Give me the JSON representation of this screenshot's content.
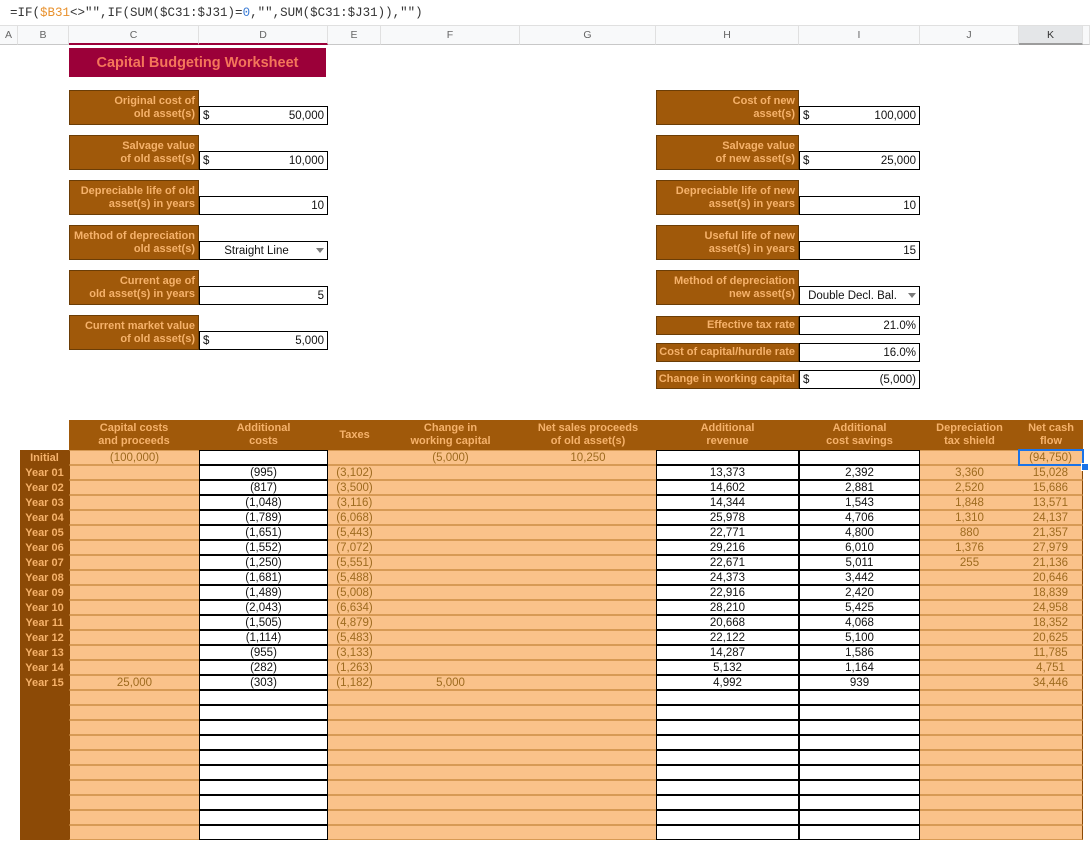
{
  "formula_bar": {
    "formula": "=IF($B31<>\"\",IF(SUM($C31:$J31)=0,\"\",SUM($C31:$J31)),\"\")",
    "parts": {
      "p1": "=IF(",
      "ref1": "$B31",
      "p2": "<>\"\",IF(SUM($C31:$J31)=",
      "num1": "0",
      "p3": ",\"\",SUM($C31:$J31)),\"\")"
    }
  },
  "columns": [
    {
      "label": "A",
      "width": 18
    },
    {
      "label": "B",
      "width": 51
    },
    {
      "label": "C",
      "width": 130
    },
    {
      "label": "D",
      "width": 129
    },
    {
      "label": "E",
      "width": 53
    },
    {
      "label": "F",
      "width": 139
    },
    {
      "label": "G",
      "width": 136
    },
    {
      "label": "H",
      "width": 143
    },
    {
      "label": "I",
      "width": 121
    },
    {
      "label": "J",
      "width": 99
    },
    {
      "label": "K",
      "width": 64
    },
    {
      "label": "",
      "width": 7
    }
  ],
  "selected_column": "K",
  "title": "Capital Budgeting Worksheet",
  "inputs_left": [
    {
      "label_line1": "Original cost of",
      "label_line2": "old asset(s)",
      "currency": "$",
      "value": "50,000",
      "type": "currency"
    },
    {
      "label_line1": "Salvage value",
      "label_line2": "of old asset(s)",
      "currency": "$",
      "value": "10,000",
      "type": "currency"
    },
    {
      "label_line1": "Depreciable life of old",
      "label_line2": "asset(s) in years",
      "currency": "",
      "value": "10",
      "type": "number"
    },
    {
      "label_line1": "Method of depreciation",
      "label_line2": "old asset(s)",
      "currency": "",
      "value": "Straight Line",
      "type": "dropdown"
    },
    {
      "label_line1": "Current age of",
      "label_line2": "old asset(s) in years",
      "currency": "",
      "value": "5",
      "type": "number"
    },
    {
      "label_line1": "Current market value",
      "label_line2": "of old asset(s)",
      "currency": "$",
      "value": "5,000",
      "type": "currency"
    }
  ],
  "inputs_right": [
    {
      "label_line1": "Cost of new",
      "label_line2": "asset(s)",
      "currency": "$",
      "value": "100,000",
      "type": "currency"
    },
    {
      "label_line1": "Salvage value",
      "label_line2": "of new asset(s)",
      "currency": "$",
      "value": "25,000",
      "type": "currency"
    },
    {
      "label_line1": "Depreciable life of new",
      "label_line2": "asset(s) in years",
      "currency": "",
      "value": "10",
      "type": "number"
    },
    {
      "label_line1": "Useful life of new",
      "label_line2": "asset(s) in years",
      "currency": "",
      "value": "15",
      "type": "number"
    },
    {
      "label_line1": "Method of depreciation",
      "label_line2": "new asset(s)",
      "currency": "",
      "value": "Double Decl. Bal.",
      "type": "dropdown"
    },
    {
      "label_line1": "",
      "label_line2": "Effective tax rate",
      "currency": "",
      "value": "21.0%",
      "type": "number"
    },
    {
      "label_line1": "",
      "label_line2": "Cost of capital/hurdle rate",
      "currency": "",
      "value": "16.0%",
      "type": "number"
    },
    {
      "label_line1": "",
      "label_line2": "Change in working capital",
      "currency": "$",
      "value": "(5,000)",
      "type": "currency"
    }
  ],
  "table": {
    "headers": [
      {
        "line1": "Capital costs",
        "line2": "and proceeds"
      },
      {
        "line1": "Additional",
        "line2": "costs"
      },
      {
        "line1": "",
        "line2": "Taxes"
      },
      {
        "line1": "Change in",
        "line2": "working capital"
      },
      {
        "line1": "Net sales proceeds",
        "line2": "of old asset(s)"
      },
      {
        "line1": "Additional",
        "line2": "revenue"
      },
      {
        "line1": "Additional",
        "line2": "cost savings"
      },
      {
        "line1": "Depreciation",
        "line2": "tax shield"
      },
      {
        "line1": "Net cash",
        "line2": "flow"
      }
    ],
    "column_kinds": [
      "calc",
      "input",
      "calc",
      "calc",
      "calc",
      "input",
      "input",
      "calc",
      "calc"
    ],
    "rows": [
      {
        "label": "Initial",
        "cells": [
          "(100,000)",
          "",
          "",
          "(5,000)",
          "10,250",
          "",
          "",
          "",
          "(94,750)"
        ]
      },
      {
        "label": "Year 01",
        "cells": [
          "",
          "(995)",
          "(3,102)",
          "",
          "",
          "13,373",
          "2,392",
          "3,360",
          "15,028"
        ]
      },
      {
        "label": "Year 02",
        "cells": [
          "",
          "(817)",
          "(3,500)",
          "",
          "",
          "14,602",
          "2,881",
          "2,520",
          "15,686"
        ]
      },
      {
        "label": "Year 03",
        "cells": [
          "",
          "(1,048)",
          "(3,116)",
          "",
          "",
          "14,344",
          "1,543",
          "1,848",
          "13,571"
        ]
      },
      {
        "label": "Year 04",
        "cells": [
          "",
          "(1,789)",
          "(6,068)",
          "",
          "",
          "25,978",
          "4,706",
          "1,310",
          "24,137"
        ]
      },
      {
        "label": "Year 05",
        "cells": [
          "",
          "(1,651)",
          "(5,443)",
          "",
          "",
          "22,771",
          "4,800",
          "880",
          "21,357"
        ]
      },
      {
        "label": "Year 06",
        "cells": [
          "",
          "(1,552)",
          "(7,072)",
          "",
          "",
          "29,216",
          "6,010",
          "1,376",
          "27,979"
        ]
      },
      {
        "label": "Year 07",
        "cells": [
          "",
          "(1,250)",
          "(5,551)",
          "",
          "",
          "22,671",
          "5,011",
          "255",
          "21,136"
        ]
      },
      {
        "label": "Year 08",
        "cells": [
          "",
          "(1,681)",
          "(5,488)",
          "",
          "",
          "24,373",
          "3,442",
          "",
          "20,646"
        ]
      },
      {
        "label": "Year 09",
        "cells": [
          "",
          "(1,489)",
          "(5,008)",
          "",
          "",
          "22,916",
          "2,420",
          "",
          "18,839"
        ]
      },
      {
        "label": "Year 10",
        "cells": [
          "",
          "(2,043)",
          "(6,634)",
          "",
          "",
          "28,210",
          "5,425",
          "",
          "24,958"
        ]
      },
      {
        "label": "Year 11",
        "cells": [
          "",
          "(1,505)",
          "(4,879)",
          "",
          "",
          "20,668",
          "4,068",
          "",
          "18,352"
        ]
      },
      {
        "label": "Year 12",
        "cells": [
          "",
          "(1,114)",
          "(5,483)",
          "",
          "",
          "22,122",
          "5,100",
          "",
          "20,625"
        ]
      },
      {
        "label": "Year 13",
        "cells": [
          "",
          "(955)",
          "(3,133)",
          "",
          "",
          "14,287",
          "1,586",
          "",
          "11,785"
        ]
      },
      {
        "label": "Year 14",
        "cells": [
          "",
          "(282)",
          "(1,263)",
          "",
          "",
          "5,132",
          "1,164",
          "",
          "4,751"
        ]
      },
      {
        "label": "Year 15",
        "cells": [
          "25,000",
          "(303)",
          "(1,182)",
          "5,000",
          "",
          "4,992",
          "939",
          "",
          "34,446"
        ]
      },
      {
        "label": "",
        "cells": [
          "",
          "",
          "",
          "",
          "",
          "",
          "",
          "",
          ""
        ]
      },
      {
        "label": "",
        "cells": [
          "",
          "",
          "",
          "",
          "",
          "",
          "",
          "",
          ""
        ]
      },
      {
        "label": "",
        "cells": [
          "",
          "",
          "",
          "",
          "",
          "",
          "",
          "",
          ""
        ]
      },
      {
        "label": "",
        "cells": [
          "",
          "",
          "",
          "",
          "",
          "",
          "",
          "",
          ""
        ]
      },
      {
        "label": "",
        "cells": [
          "",
          "",
          "",
          "",
          "",
          "",
          "",
          "",
          ""
        ]
      },
      {
        "label": "",
        "cells": [
          "",
          "",
          "",
          "",
          "",
          "",
          "",
          "",
          ""
        ]
      },
      {
        "label": "",
        "cells": [
          "",
          "",
          "",
          "",
          "",
          "",
          "",
          "",
          ""
        ]
      },
      {
        "label": "",
        "cells": [
          "",
          "",
          "",
          "",
          "",
          "",
          "",
          "",
          ""
        ]
      },
      {
        "label": "",
        "cells": [
          "",
          "",
          "",
          "",
          "",
          "",
          "",
          "",
          ""
        ]
      },
      {
        "label": "",
        "cells": [
          "",
          "",
          "",
          "",
          "",
          "",
          "",
          "",
          ""
        ]
      }
    ]
  },
  "selected_cell": {
    "value": "(94,750)"
  },
  "colors": {
    "title_bg": "#9B0039",
    "title_fg": "#F4765A",
    "label_bg": "#A0590A",
    "label_fg": "#F6B26B",
    "rowhdr_bg": "#8C4A06",
    "calc_bg": "#FAC28A",
    "calc_fg": "#9E6B1F",
    "selection": "#1a73e8"
  }
}
